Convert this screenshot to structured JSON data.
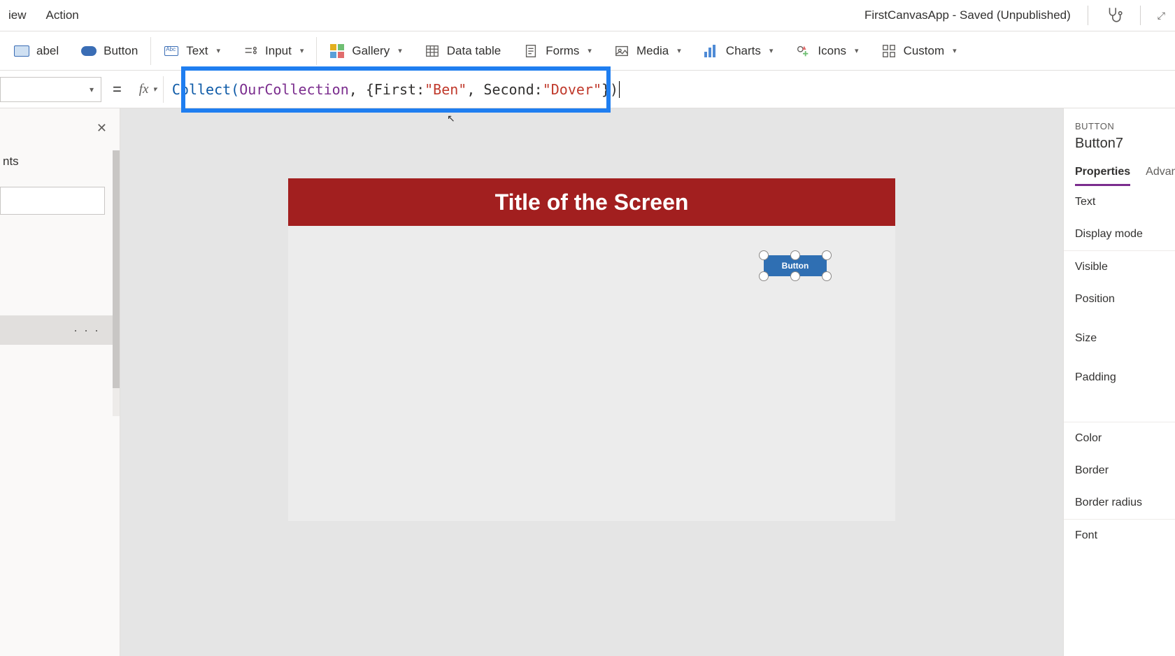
{
  "header": {
    "tabs": {
      "view": "iew",
      "action": "Action"
    },
    "app_title": "FirstCanvasApp - Saved (Unpublished)"
  },
  "ribbon": {
    "label": "abel",
    "button": "Button",
    "text": "Text",
    "input": "Input",
    "gallery": "Gallery",
    "datatable": "Data table",
    "forms": "Forms",
    "media": "Media",
    "charts": "Charts",
    "icons": "Icons",
    "custom": "Custom"
  },
  "formula": {
    "equals": "=",
    "fx": "fx",
    "tokens": {
      "fn": "Collect",
      "lparen": "(",
      "id": "OurCollection",
      "mid": ", {First: ",
      "str1": "\"Ben\"",
      "mid2": ", Second: ",
      "str2": "\"Dover\"",
      "end": "})"
    }
  },
  "left_panel": {
    "tab": "nts",
    "more": "· · ·"
  },
  "canvas": {
    "screen_title": "Title of the Screen",
    "button_text": "Button"
  },
  "right_panel": {
    "type_label": "BUTTON",
    "control_name": "Button7",
    "tabs": {
      "properties": "Properties",
      "advanced": "Advan"
    },
    "rows": {
      "text": "Text",
      "display_mode": "Display mode",
      "visible": "Visible",
      "position": "Position",
      "size": "Size",
      "padding": "Padding",
      "color": "Color",
      "border": "Border",
      "border_radius": "Border radius",
      "font": "Font"
    }
  }
}
